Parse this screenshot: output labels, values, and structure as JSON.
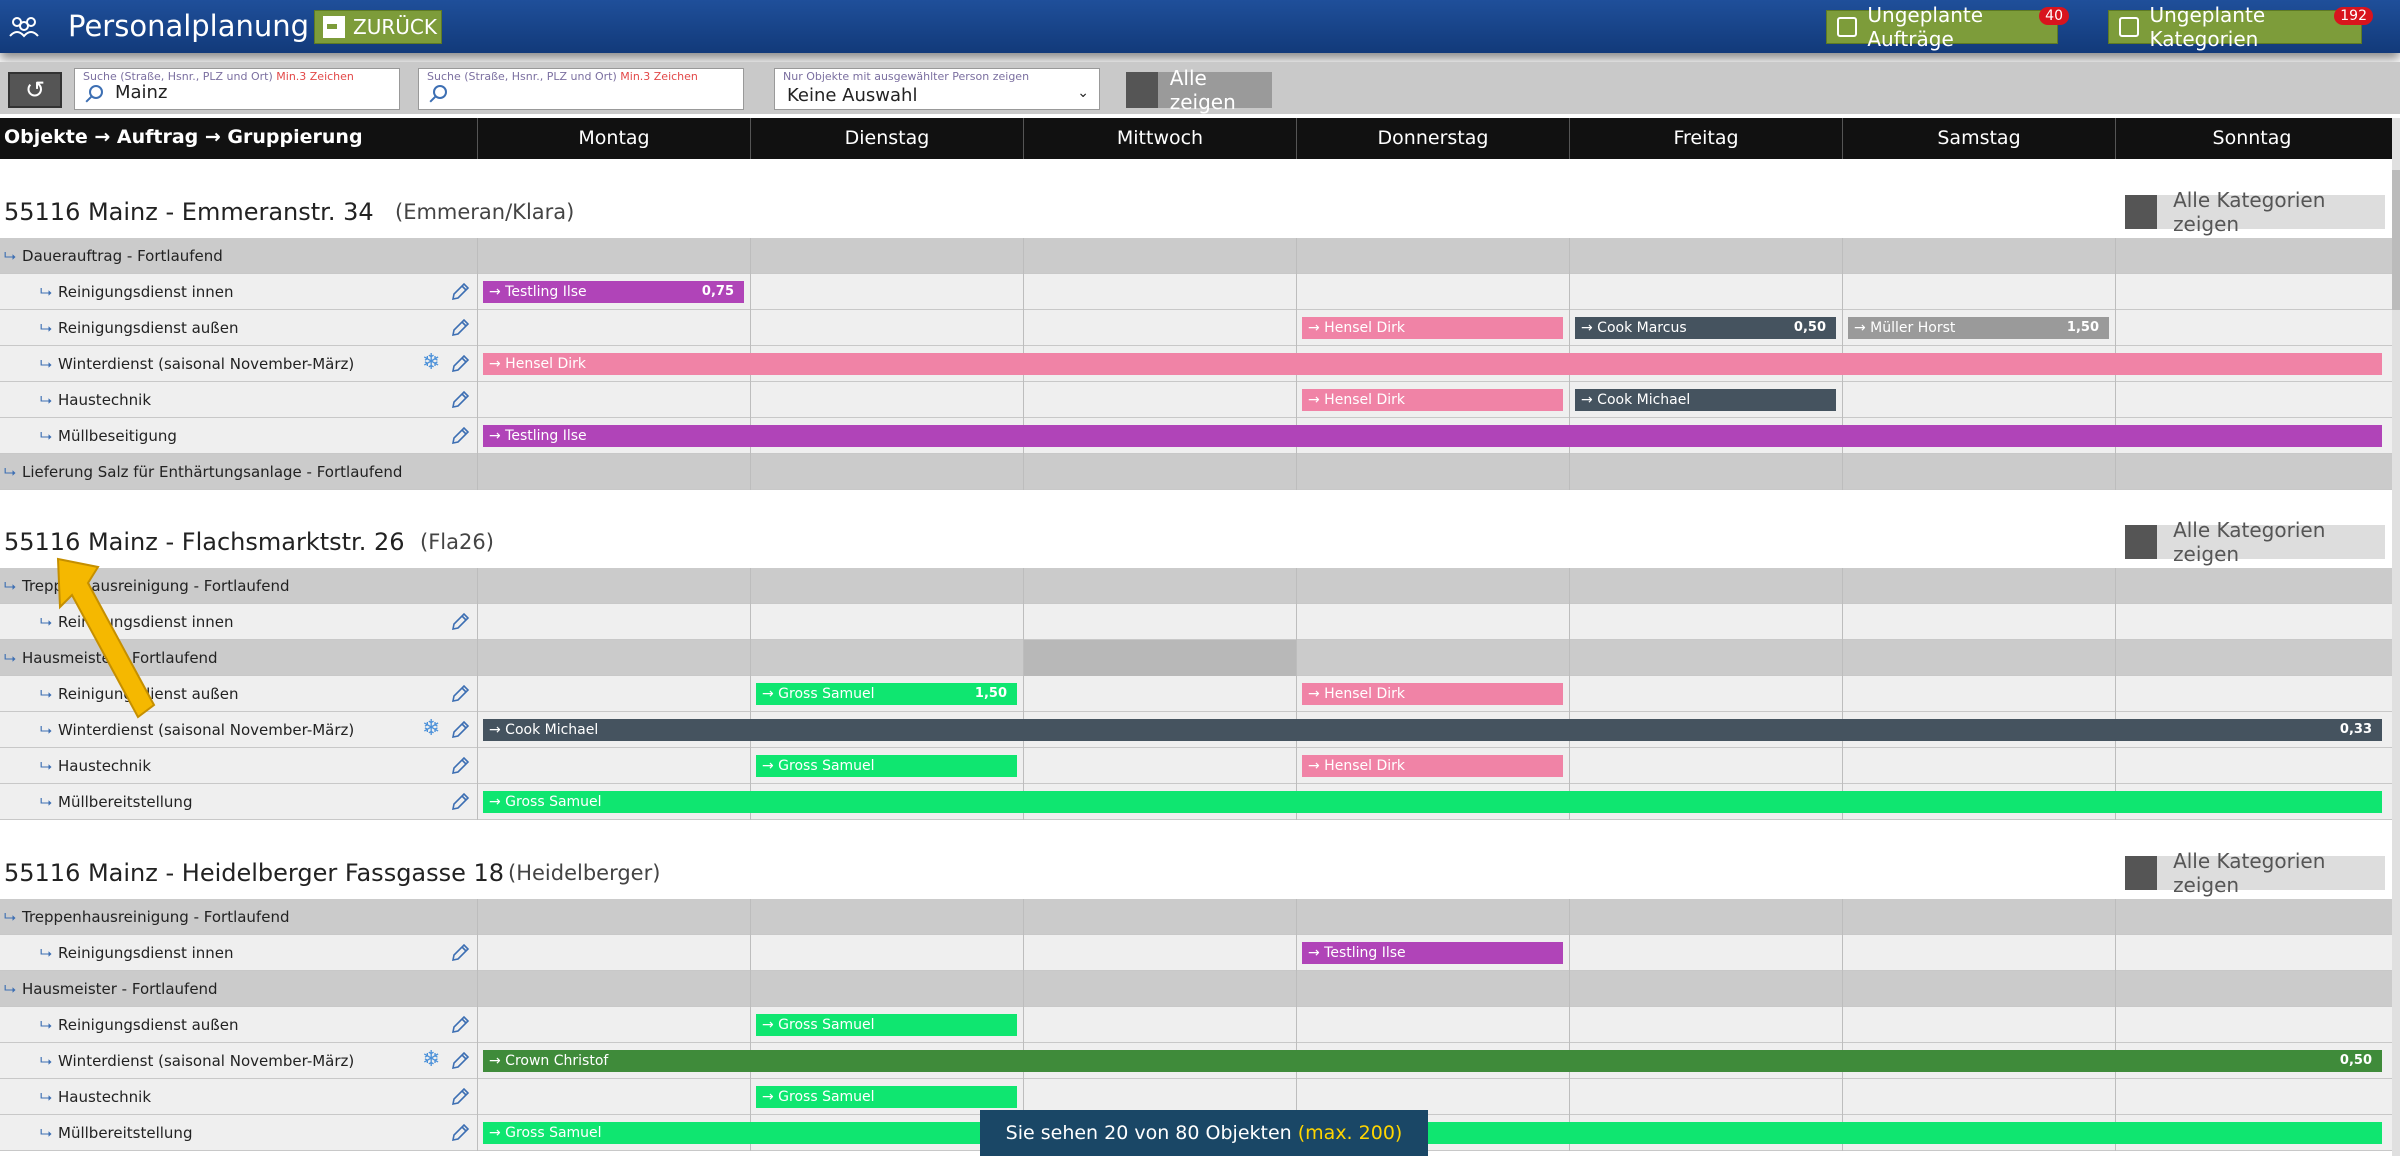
{
  "app": {
    "title": "Personalplanung",
    "back_label": "ZURÜCK"
  },
  "top_buttons": {
    "unplanned_orders": {
      "label": "Ungeplante Aufträge",
      "count": "40"
    },
    "unplanned_categories": {
      "label": "Ungeplante Kategorien",
      "count": "192"
    }
  },
  "search": {
    "field1": {
      "hint": "Suche (Straße, Hsnr., PLZ und Ort)",
      "min": "Min.3 Zeichen",
      "value": "Mainz"
    },
    "field2": {
      "hint": "Suche (Straße, Hsnr., PLZ und Ort)",
      "min": "Min.3 Zeichen",
      "value": ""
    },
    "person": {
      "hint": "Nur Objekte mit ausgewählter Person zeigen",
      "value": "Keine Auswahl"
    },
    "show_all_label": "Alle zeigen"
  },
  "header": {
    "first": "Objekte → Auftrag → Gruppierung",
    "days": [
      "Montag",
      "Dienstag",
      "Mittwoch",
      "Donnerstag",
      "Freitag",
      "Samstag",
      "Sonntag"
    ]
  },
  "category_button_label": "Alle Kategorien zeigen",
  "colors": {
    "purple": "#b044b8",
    "pink": "#f083a6",
    "slate": "#45535f",
    "gray": "#9a9a9a",
    "green": "#0fe670",
    "darkgreen": "#3f8b3a"
  },
  "sections": [
    {
      "title": "55116 Mainz - Emmeranstr. 34",
      "short": "(Emmeran/Klara)",
      "rows": [
        {
          "type": "order",
          "label": "Dauerauftrag - Fortlaufend"
        },
        {
          "type": "sub",
          "label": "Reinigungsdienst innen",
          "bars": [
            {
              "start": 0,
              "end": 1,
              "color": "purple",
              "name": "→ Testling Ilse",
              "hours": "0,75"
            }
          ]
        },
        {
          "type": "sub",
          "label": "Reinigungsdienst außen",
          "bars": [
            {
              "start": 3,
              "end": 4,
              "color": "pink",
              "name": "→ Hensel Dirk",
              "hours": ""
            },
            {
              "start": 4,
              "end": 5,
              "color": "slate",
              "name": "→ Cook Marcus",
              "hours": "0,50"
            },
            {
              "start": 5,
              "end": 6,
              "color": "gray",
              "name": "→ Müller Horst",
              "hours": "1,50"
            }
          ]
        },
        {
          "type": "sub",
          "label": "Winterdienst (saisonal November-März)",
          "snow": true,
          "bars": [
            {
              "start": 0,
              "end": 7,
              "color": "pink",
              "name": "→ Hensel Dirk",
              "hours": ""
            }
          ]
        },
        {
          "type": "sub",
          "label": "Haustechnik",
          "bars": [
            {
              "start": 3,
              "end": 4,
              "color": "pink",
              "name": "→ Hensel Dirk",
              "hours": ""
            },
            {
              "start": 4,
              "end": 5,
              "color": "slate",
              "name": "→ Cook Michael",
              "hours": ""
            }
          ]
        },
        {
          "type": "sub",
          "label": "Müllbeseitigung",
          "bars": [
            {
              "start": 0,
              "end": 7,
              "color": "purple",
              "name": "→ Testling Ilse",
              "hours": ""
            }
          ]
        },
        {
          "type": "order",
          "label": "Lieferung Salz für Enthärtungsanlage - Fortlaufend"
        }
      ]
    },
    {
      "title": "55116 Mainz - Flachsmarktstr. 26",
      "short": "(Fla26)",
      "rows": [
        {
          "type": "order",
          "label": "Treppenhausreinigung - Fortlaufend"
        },
        {
          "type": "sub",
          "label": "Reinigungsdienst innen",
          "bars": []
        },
        {
          "type": "order",
          "label": "Hausmeister - Fortlaufend",
          "dim": 2
        },
        {
          "type": "sub",
          "label": "Reinigungsdienst außen",
          "bars": [
            {
              "start": 1,
              "end": 2,
              "color": "green",
              "name": "→ Gross Samuel",
              "hours": "1,50"
            },
            {
              "start": 3,
              "end": 4,
              "color": "pink",
              "name": "→ Hensel Dirk",
              "hours": ""
            }
          ]
        },
        {
          "type": "sub",
          "label": "Winterdienst (saisonal November-März)",
          "snow": true,
          "bars": [
            {
              "start": 0,
              "end": 7,
              "color": "slate",
              "name": "→ Cook Michael",
              "hours": "0,33"
            }
          ]
        },
        {
          "type": "sub",
          "label": "Haustechnik",
          "bars": [
            {
              "start": 1,
              "end": 2,
              "color": "green",
              "name": "→ Gross Samuel",
              "hours": ""
            },
            {
              "start": 3,
              "end": 4,
              "color": "pink",
              "name": "→ Hensel Dirk",
              "hours": ""
            }
          ]
        },
        {
          "type": "sub",
          "label": "Müllbereitstellung",
          "bars": [
            {
              "start": 0,
              "end": 7,
              "color": "green",
              "name": "→ Gross Samuel",
              "hours": ""
            }
          ]
        }
      ]
    },
    {
      "title": "55116 Mainz - Heidelberger Fassgasse 18",
      "short": "(Heidelberger)",
      "rows": [
        {
          "type": "order",
          "label": "Treppenhausreinigung - Fortlaufend"
        },
        {
          "type": "sub",
          "label": "Reinigungsdienst innen",
          "bars": [
            {
              "start": 3,
              "end": 4,
              "color": "purple",
              "name": "→ Testling Ilse",
              "hours": ""
            }
          ]
        },
        {
          "type": "order",
          "label": "Hausmeister - Fortlaufend"
        },
        {
          "type": "sub",
          "label": "Reinigungsdienst außen",
          "bars": [
            {
              "start": 1,
              "end": 2,
              "color": "green",
              "name": "→ Gross Samuel",
              "hours": ""
            }
          ]
        },
        {
          "type": "sub",
          "label": "Winterdienst (saisonal November-März)",
          "snow": true,
          "bars": [
            {
              "start": 0,
              "end": 7,
              "color": "darkgreen",
              "name": "→ Crown Christof",
              "hours": "0,50"
            }
          ]
        },
        {
          "type": "sub",
          "label": "Haustechnik",
          "bars": [
            {
              "start": 1,
              "end": 2,
              "color": "green",
              "name": "→ Gross Samuel",
              "hours": ""
            }
          ]
        },
        {
          "type": "sub",
          "label": "Müllbereitstellung",
          "bars": [
            {
              "start": 0,
              "end": 7,
              "color": "green",
              "name": "→ Gross Samuel",
              "hours": ""
            }
          ]
        }
      ]
    }
  ],
  "footer": {
    "text": "Sie sehen 20 von 80 Objekten",
    "max": "(max. 200)"
  }
}
